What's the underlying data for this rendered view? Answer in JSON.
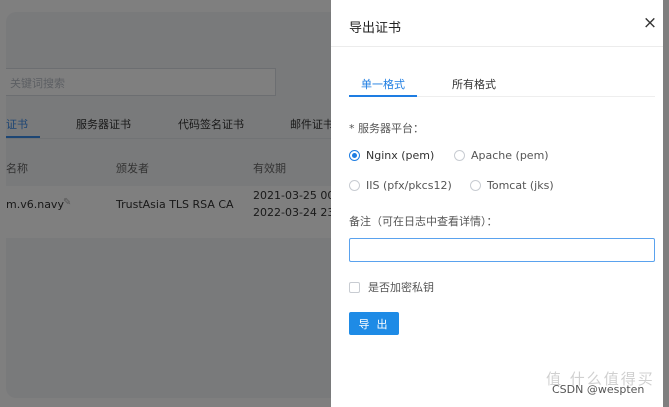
{
  "background": {
    "search_placeholder": "关键词搜索",
    "tabs": [
      "证书",
      "服务器证书",
      "代码签名证书",
      "邮件证书"
    ],
    "columns": [
      "名称",
      "颁发者",
      "有效期"
    ],
    "row": {
      "name": "m.v6.navy",
      "issuer": "TrustAsia TLS RSA CA",
      "valid_from": "2021-03-25 00",
      "valid_to": "2022-03-24 23:"
    }
  },
  "drawer": {
    "title": "导出证书",
    "close_glyph": "×",
    "tabs": [
      {
        "label": "单一格式",
        "active": true
      },
      {
        "label": "所有格式",
        "active": false
      }
    ],
    "platform_label": "* 服务器平台：",
    "platforms": [
      {
        "label": "Nginx (pem)",
        "selected": true
      },
      {
        "label": "Apache (pem)",
        "selected": false
      },
      {
        "label": "IIS (pfx/pkcs12)",
        "selected": false
      },
      {
        "label": "Tomcat (jks)",
        "selected": false
      }
    ],
    "note_label": "备注（可在日志中查看详情）：",
    "note_value": "",
    "encrypt_label": "是否加密私钥",
    "encrypt_checked": false,
    "export_button": "导 出"
  },
  "watermark": {
    "site": "值 什么值得买",
    "credit": "CSDN @wespten"
  },
  "colors": {
    "accent": "#1e7de2",
    "button": "#1e8be6",
    "overlay": "rgba(0,0,0,0.5)"
  }
}
